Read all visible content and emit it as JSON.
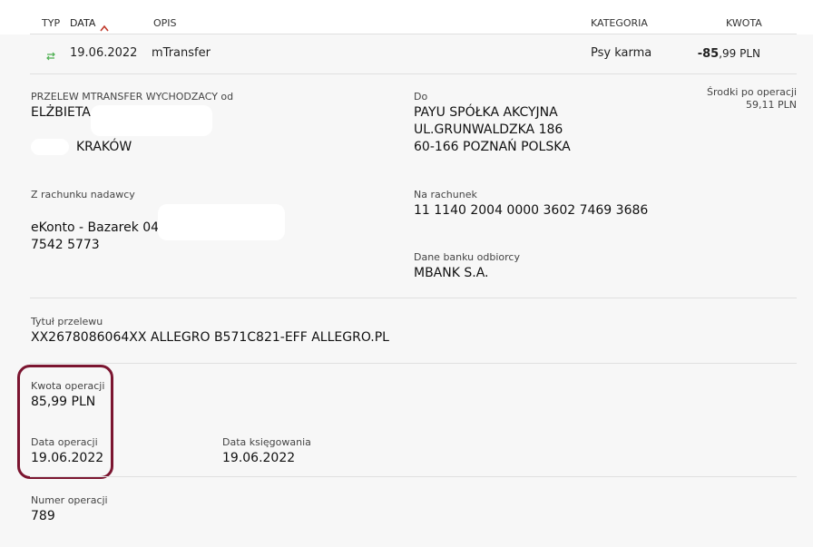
{
  "header": {
    "col_type": "TYP",
    "col_date": "DATA",
    "col_desc": "OPIS",
    "col_category": "KATEGORIA",
    "col_amount": "KWOTA",
    "accent_color": "#c0392b"
  },
  "transaction": {
    "type_icon": "transfer-arrows-icon",
    "date": "19.06.2022",
    "description": "mTransfer",
    "category": "Psy karma",
    "amount_int": "-85",
    "amount_dec": ",99 PLN"
  },
  "details": {
    "sender_label": "PRZELEW MTRANSFER WYCHODZACY od",
    "sender_name": "ELŻBIETA",
    "sender_city": "KRAKÓW",
    "to_label": "Do",
    "to_line1": "PAYU SPÓŁKA AKCYJNA",
    "to_line2": "UL.GRUNWALDZKA 186",
    "to_line3": "60-166 POZNAŃ POLSKA",
    "balance_label": "Środki po operacji",
    "balance_value": "59,11 PLN",
    "from_account_label": "Z rachunku nadawcy",
    "from_account_line1": "eKonto - Bazarek 04",
    "from_account_line2": "7542 5773",
    "to_account_label": "Na rachunek",
    "to_account_value": "11 1140 2004 0000 3602 7469 3686",
    "bank_label": "Dane banku odbiorcy",
    "bank_value": "MBANK S.A.",
    "title_label": "Tytuł przelewu",
    "title_value": "XX2678086064XX ALLEGRO B571C821-EFF ALLEGRO.PL",
    "op_amount_label": "Kwota operacji",
    "op_amount_value": "85,99 PLN",
    "op_date_label": "Data operacji",
    "op_date_value": "19.06.2022",
    "post_date_label": "Data księgowania",
    "post_date_value": "19.06.2022",
    "op_number_label": "Numer operacji",
    "op_number_value": "789"
  },
  "highlight_color": "#7b1530"
}
